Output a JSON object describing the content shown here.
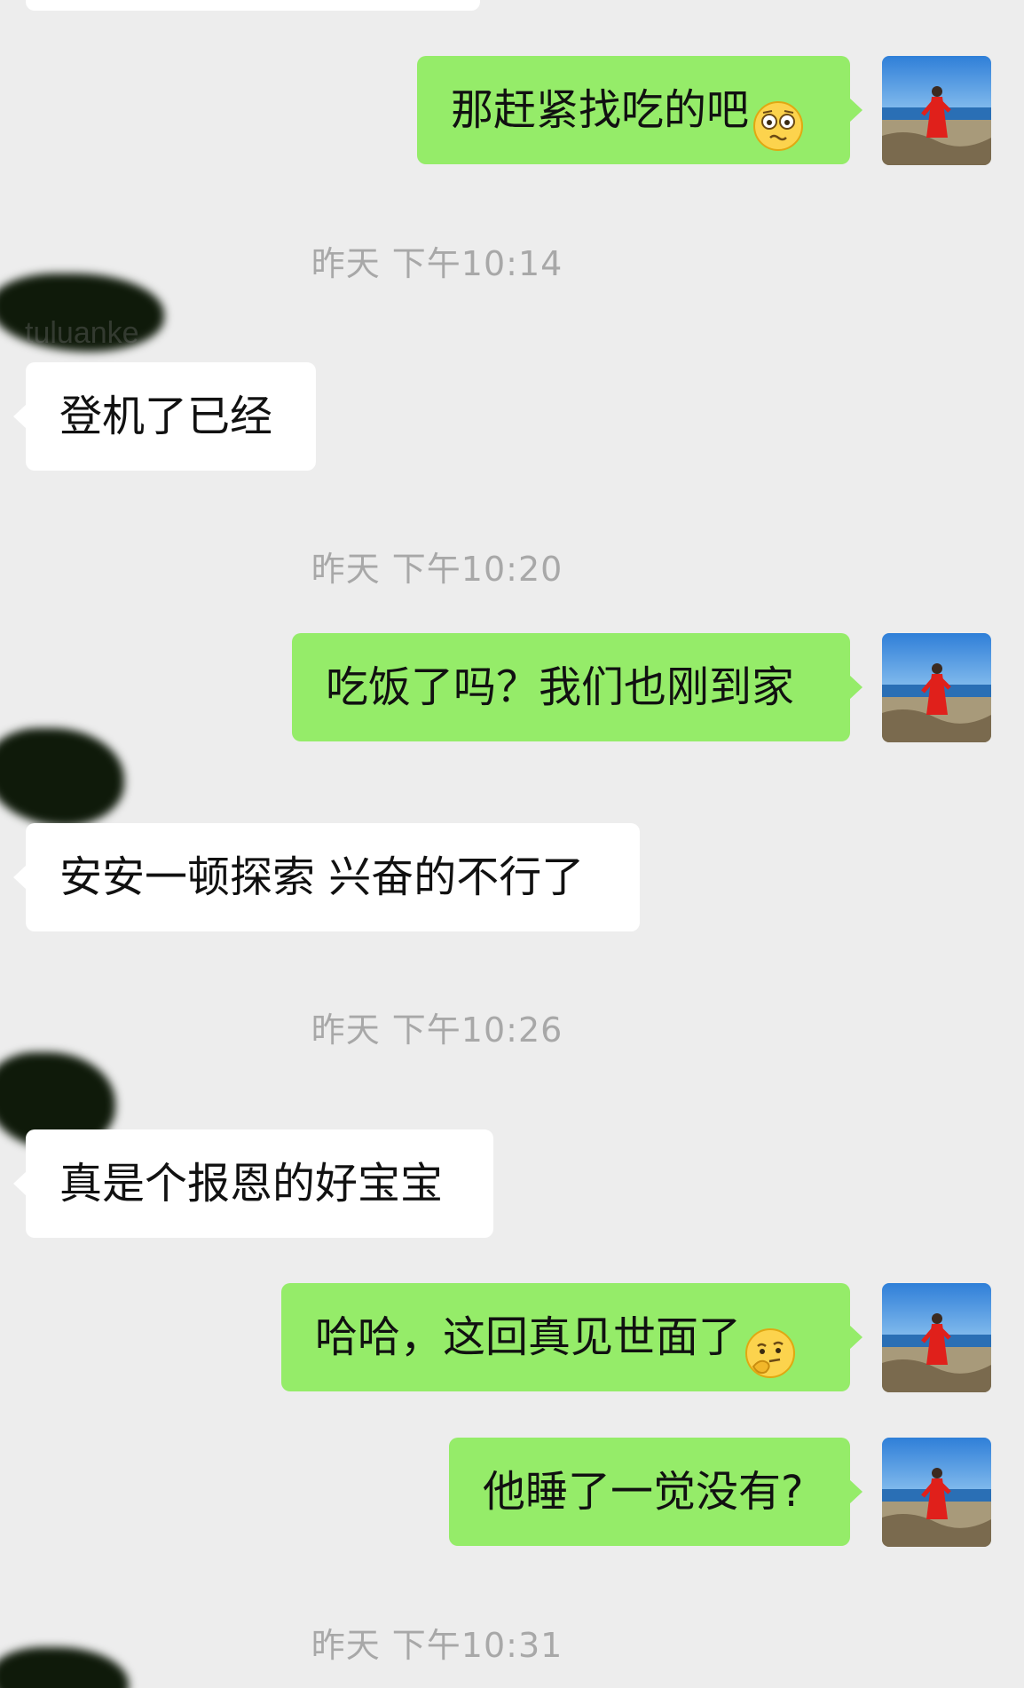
{
  "messages": [
    {
      "type": "sent",
      "text": "那赶紧找吃的吧",
      "emoji": "worried-face-icon"
    },
    {
      "type": "timestamp",
      "text": "昨天 下午10:14"
    },
    {
      "type": "received",
      "sender": "tuluanke",
      "text": "登机了已经"
    },
    {
      "type": "timestamp",
      "text": "昨天 下午10:20"
    },
    {
      "type": "sent",
      "text": "吃饭了吗？我们也刚到家"
    },
    {
      "type": "received",
      "sender": "",
      "text": "安安一顿探索 兴奋的不行了"
    },
    {
      "type": "timestamp",
      "text": "昨天 下午10:26"
    },
    {
      "type": "received",
      "sender": "",
      "text": "真是个报恩的好宝宝"
    },
    {
      "type": "sent",
      "text": "哈哈，这回真见世面了",
      "emoji": "thinking-face-icon"
    },
    {
      "type": "sent",
      "text": "他睡了一觉没有?"
    },
    {
      "type": "timestamp",
      "text": "昨天 下午10:31"
    }
  ],
  "colors": {
    "background": "#ededed",
    "sent_bubble": "#95ec69",
    "received_bubble": "#ffffff",
    "timestamp_text": "#a8a8a8"
  }
}
